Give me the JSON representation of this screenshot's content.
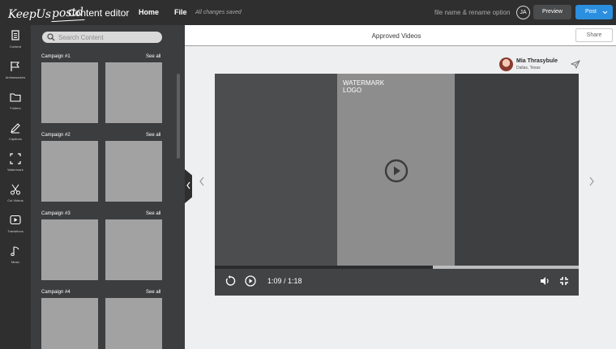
{
  "brand": {
    "logo_part1": "KeepUs",
    "logo_part2": "postd",
    "app_title": "Content editor"
  },
  "topbar": {
    "home_label": "Home",
    "file_label": "File",
    "saved_status": "All changes saved",
    "rename_option": "file name & rename option",
    "avatar_initials": "JA",
    "preview_label": "Preview",
    "post_label": "Post",
    "post_color": "#2b8fe0"
  },
  "rail": [
    {
      "label": "Content",
      "icon": "document-icon"
    },
    {
      "label": "Ambassadors",
      "icon": "flag-icon"
    },
    {
      "label": "Folders",
      "icon": "folder-icon"
    },
    {
      "label": "Captions",
      "icon": "pen-icon"
    },
    {
      "label": "Watermark",
      "icon": "frame-icon"
    },
    {
      "label": "Cut Videos",
      "icon": "scissors-icon"
    },
    {
      "label": "Transitions",
      "icon": "play-square-icon"
    },
    {
      "label": "Music",
      "icon": "music-note-icon"
    }
  ],
  "panel": {
    "search_placeholder": "Search Content",
    "see_all_label": "See all",
    "campaigns": [
      {
        "title": "Campaign #1"
      },
      {
        "title": "Campaign #2"
      },
      {
        "title": "Campaign #3"
      },
      {
        "title": "Campaign #4"
      }
    ]
  },
  "main": {
    "title": "Approved Videos",
    "share_label": "Share",
    "user_name": "Mia Thrasybule",
    "user_location": "Dallas, Texas"
  },
  "player": {
    "watermark_line1": "WATERMARK",
    "watermark_line2": "LOGO",
    "time_display": "1:09 / 1:18",
    "progress": 0.6
  }
}
